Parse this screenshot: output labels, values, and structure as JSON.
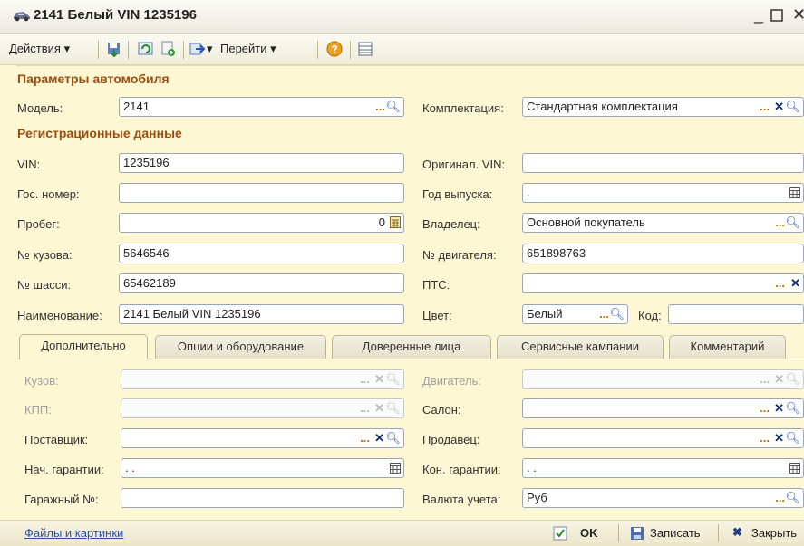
{
  "window": {
    "title": "2141 Белый VIN 1235196"
  },
  "toolbar": {
    "actions": "Действия",
    "goto": "Перейти"
  },
  "sections": {
    "car_params": "Параметры автомобиля",
    "reg_data": "Регистрационные данные"
  },
  "fields": {
    "model": {
      "label": "Модель:",
      "value": "2141"
    },
    "complect": {
      "label": "Комплектация:",
      "value": "Стандартная комплектация"
    },
    "vin": {
      "label": "VIN:",
      "value": "1235196"
    },
    "orig_vin": {
      "label": "Оригинал. VIN:",
      "value": ""
    },
    "gos_nomer": {
      "label": "Гос. номер:",
      "value": ""
    },
    "god_vypuska": {
      "label": "Год выпуска:",
      "value": "."
    },
    "probeg": {
      "label": "Пробег:",
      "value": "0"
    },
    "vladelec": {
      "label": "Владелец:",
      "value": "Основной покупатель"
    },
    "kuzov_no": {
      "label": "№ кузова:",
      "value": "5646546"
    },
    "dvig_no": {
      "label": "№ двигателя:",
      "value": "651898763"
    },
    "shassi_no": {
      "label": "№ шасси:",
      "value": "65462189"
    },
    "pts": {
      "label": "ПТС:",
      "value": ""
    },
    "naimenovanie": {
      "label": "Наименование:",
      "value": "2141 Белый VIN 1235196"
    },
    "cvet": {
      "label": "Цвет:",
      "value": "Белый"
    },
    "kod": {
      "label": "Код:",
      "value": ""
    }
  },
  "tabs": [
    "Дополнительно",
    "Опции и оборудование",
    "Доверенные лица",
    "Сервисные кампании",
    "Комментарий"
  ],
  "extra": {
    "kuzov": {
      "label": "Кузов:",
      "value": ""
    },
    "dvigatel": {
      "label": "Двигатель:",
      "value": ""
    },
    "kpp": {
      "label": "КПП:",
      "value": ""
    },
    "salon": {
      "label": "Салон:",
      "value": ""
    },
    "postavshik": {
      "label": "Поставщик:",
      "value": ""
    },
    "prodavec": {
      "label": "Продавец:",
      "value": ""
    },
    "nach_garantii": {
      "label": "Нач. гарантии:",
      "value": ". ."
    },
    "kon_garantii": {
      "label": "Кон. гарантии:",
      "value": ". ."
    },
    "garazh": {
      "label": "Гаражный №:",
      "value": ""
    },
    "valuta": {
      "label": "Валюта учета:",
      "value": "Руб"
    }
  },
  "status": {
    "files_link": "Файлы и картинки",
    "ok": "OK",
    "save": "Записать",
    "close": "Закрыть"
  },
  "colors": {
    "section": "#9b4e10",
    "background": "#fdf7d4",
    "link": "#2d4fa6"
  }
}
